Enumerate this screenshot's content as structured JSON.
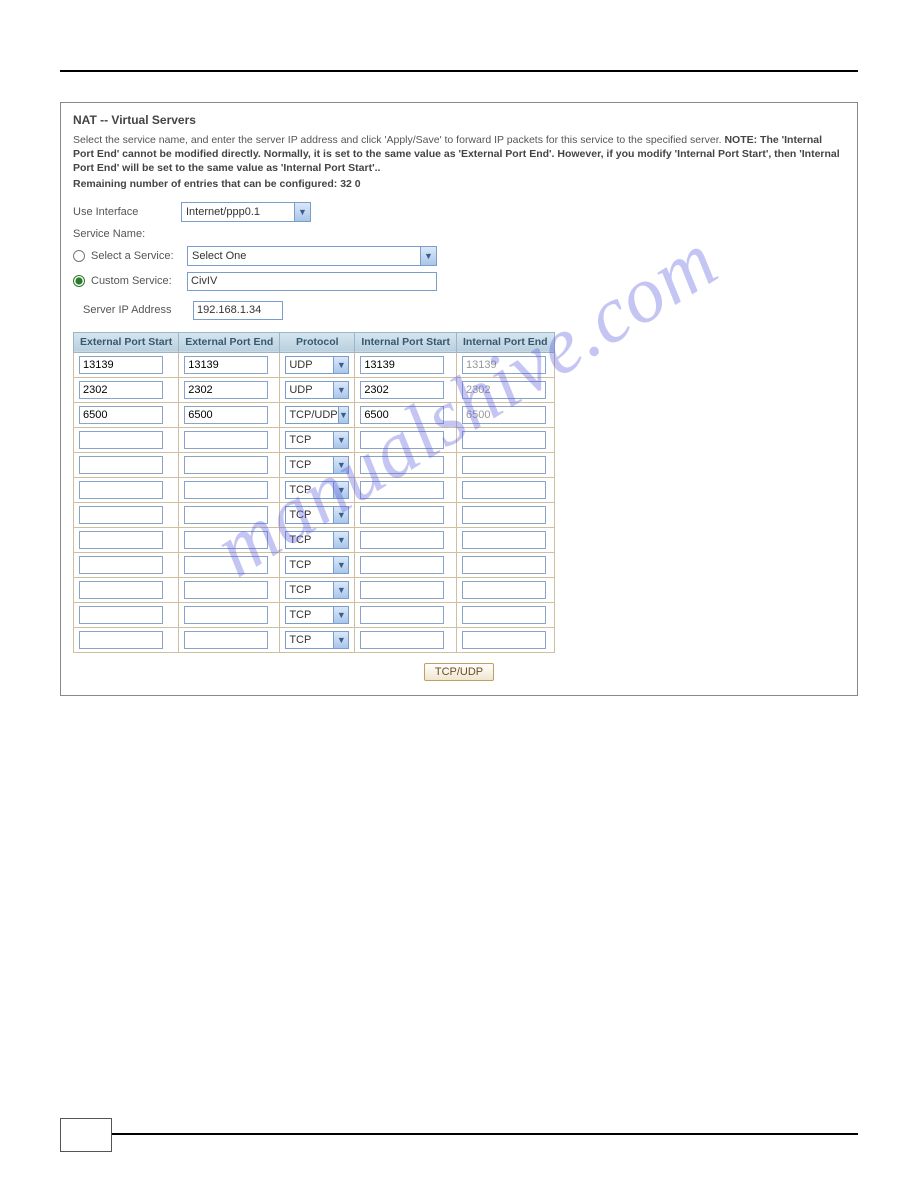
{
  "watermark": "manualshive.com",
  "panel": {
    "title": "NAT -- Virtual Servers",
    "desc_pre": "Select the service name, and enter the server IP address and click 'Apply/Save' to forward IP packets for this service to the specified server. ",
    "desc_note": "NOTE: The 'Internal Port End' cannot be modified directly. Normally, it is set to the same value as  'External Port End'. However, if you modify 'Internal Port Start', then 'Internal Port End' will be set to the same value as 'Internal Port Start'..",
    "remaining": "Remaining number of entries that can be configured: 32 0",
    "use_interface_label": "Use Interface",
    "use_interface_value": "Internet/ppp0.1",
    "service_name_label": "Service Name:",
    "select_service_label": "Select a Service:",
    "select_service_value": "Select One",
    "custom_service_label": "Custom Service:",
    "custom_service_value": "CivIV",
    "server_ip_label": "Server IP Address",
    "server_ip_value": "192.168.1.34"
  },
  "table": {
    "headers": [
      "External Port Start",
      "External Port End",
      "Protocol",
      "Internal Port Start",
      "Internal Port End"
    ],
    "rows": [
      {
        "eps": "13139",
        "epe": "13139",
        "proto": "UDP",
        "ips": "13139",
        "ipe": "13139"
      },
      {
        "eps": "2302",
        "epe": "2302",
        "proto": "UDP",
        "ips": "2302",
        "ipe": "2302"
      },
      {
        "eps": "6500",
        "epe": "6500",
        "proto": "TCP/UDP",
        "ips": "6500",
        "ipe": "6500"
      },
      {
        "eps": "",
        "epe": "",
        "proto": "TCP",
        "ips": "",
        "ipe": ""
      },
      {
        "eps": "",
        "epe": "",
        "proto": "TCP",
        "ips": "",
        "ipe": ""
      },
      {
        "eps": "",
        "epe": "",
        "proto": "TCP",
        "ips": "",
        "ipe": ""
      },
      {
        "eps": "",
        "epe": "",
        "proto": "TCP",
        "ips": "",
        "ipe": ""
      },
      {
        "eps": "",
        "epe": "",
        "proto": "TCP",
        "ips": "",
        "ipe": ""
      },
      {
        "eps": "",
        "epe": "",
        "proto": "TCP",
        "ips": "",
        "ipe": ""
      },
      {
        "eps": "",
        "epe": "",
        "proto": "TCP",
        "ips": "",
        "ipe": ""
      },
      {
        "eps": "",
        "epe": "",
        "proto": "TCP",
        "ips": "",
        "ipe": ""
      },
      {
        "eps": "",
        "epe": "",
        "proto": "TCP",
        "ips": "",
        "ipe": ""
      }
    ]
  },
  "bottom_button": "TCP/UDP"
}
